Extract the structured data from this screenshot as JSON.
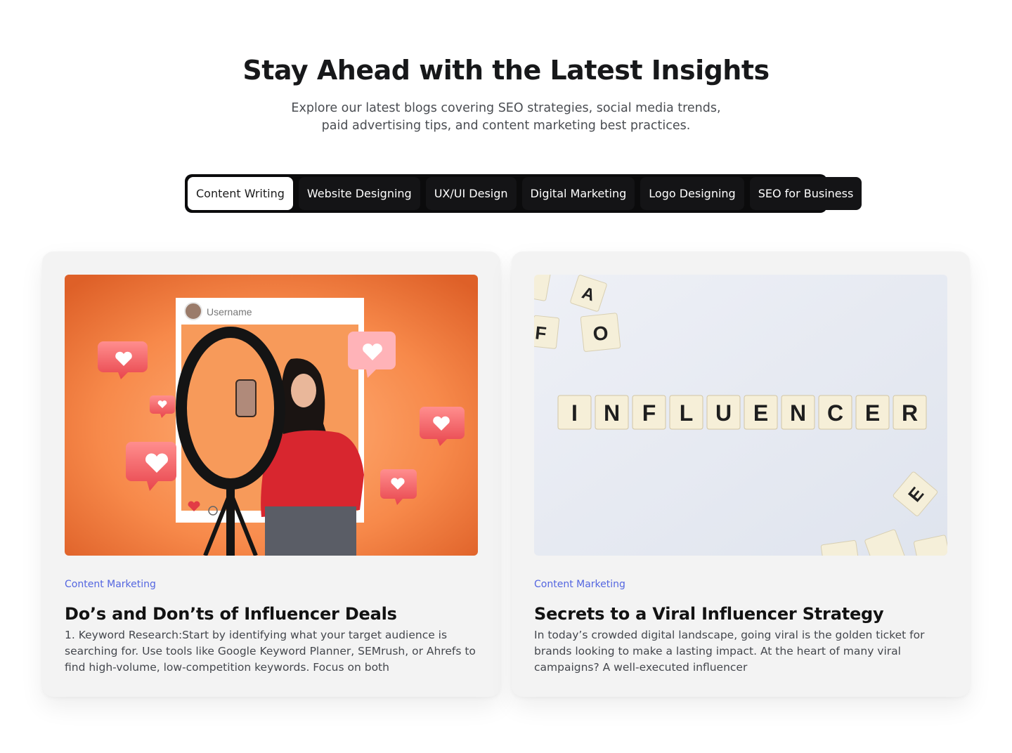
{
  "hero": {
    "title": "Stay Ahead with the Latest Insights",
    "subtitle": "Explore our latest blogs covering SEO strategies, social media trends, paid advertising tips, and content marketing best practices."
  },
  "tabs": [
    {
      "label": "Content Writing",
      "active": true
    },
    {
      "label": "Website Designing",
      "active": false
    },
    {
      "label": "UX/UI Design",
      "active": false
    },
    {
      "label": "Digital Marketing",
      "active": false
    },
    {
      "label": "Logo Designing",
      "active": false
    },
    {
      "label": "SEO for Business",
      "active": false
    }
  ],
  "posts": [
    {
      "category": "Content Marketing",
      "title": "Do’s and Don’ts of Influencer Deals",
      "excerpt": "1. Keyword Research:Start by identifying what your target audience is searching for. Use tools like Google Keyword Planner, SEMrush, or Ahrefs to find high-volume, low-competition keywords. Focus on both",
      "image": {
        "post_username": "Username"
      }
    },
    {
      "category": "Content Marketing",
      "title": "Secrets to a Viral Influencer Strategy",
      "excerpt": "In today’s crowded digital landscape, going viral is the golden ticket for brands looking to make a lasting impact. At the heart of many viral campaigns? A well-executed influencer",
      "image": {
        "tiles": "INFLUENCER"
      }
    }
  ],
  "colors": {
    "accent_category": "#5466e0",
    "tab_bar": "#0b0b0c",
    "card_bg": "#f3f3f3"
  }
}
